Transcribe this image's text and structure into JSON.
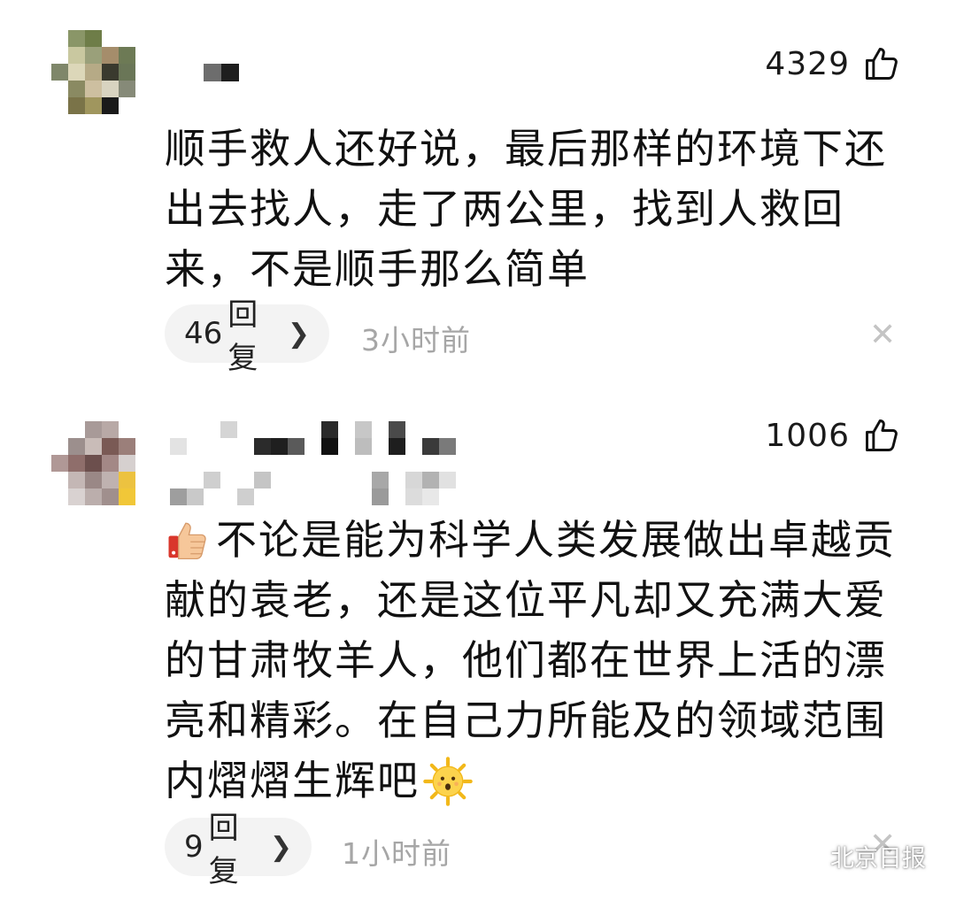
{
  "comments": [
    {
      "likes": "4329",
      "text": "顺手救人还好说，最后那样的环境下还出去找人，走了两公里，找到人救回来，不是顺手那么简单",
      "reply_count": "46",
      "reply_label": "回复",
      "time": "3小时前"
    },
    {
      "likes": "1006",
      "text": "不论是能为科学人类发展做出卓越贡献的袁老，还是这位平凡却又充满大爱的甘肃牧羊人，他们都在世界上活的漂亮和精彩。在自己力所能及的领域范围内熠熠生辉吧",
      "reply_count": "9",
      "reply_label": "回复",
      "time": "1小时前"
    }
  ],
  "icons": {
    "like": "thumbs-up-icon",
    "close": "close-icon",
    "chevron": "chevron-right-icon",
    "emoji_start": "thumbs-up-emoji",
    "emoji_end": "sun-face-emoji",
    "watermark": "wechat-icon"
  },
  "watermark": {
    "text": "北京日报"
  },
  "colors": {
    "time": "#a6a6a6",
    "pill_bg": "#f3f3f3",
    "close": "#c4c4c4"
  }
}
